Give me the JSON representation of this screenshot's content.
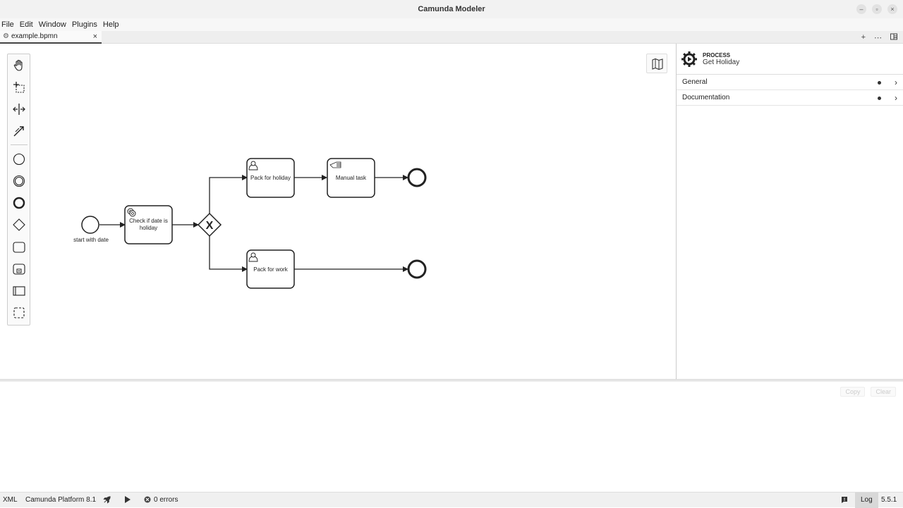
{
  "window": {
    "title": "Camunda Modeler"
  },
  "menu": [
    "File",
    "Edit",
    "Window",
    "Plugins",
    "Help"
  ],
  "tab": {
    "label": "example.bpmn",
    "close": "×"
  },
  "tab_actions": {
    "add": "+",
    "more": "⋯"
  },
  "diagram": {
    "start_event_label": "start with date",
    "service_task": "Check if date is holiday",
    "service_task_line1": "Check if date is",
    "service_task_line2": "holiday",
    "user_task_1": "Pack for holiday",
    "manual_task": "Manual task",
    "user_task_2": "Pack for work",
    "gateway_symbol": "X"
  },
  "properties": {
    "type": "PROCESS",
    "name": "Get Holiday",
    "groups": [
      "General",
      "Documentation"
    ]
  },
  "log": {
    "copy": "Copy",
    "clear": "Clear"
  },
  "status": {
    "xml": "XML",
    "platform": "Camunda Platform 8.1",
    "errors": "0 errors",
    "log": "Log",
    "version": "5.5.1"
  }
}
